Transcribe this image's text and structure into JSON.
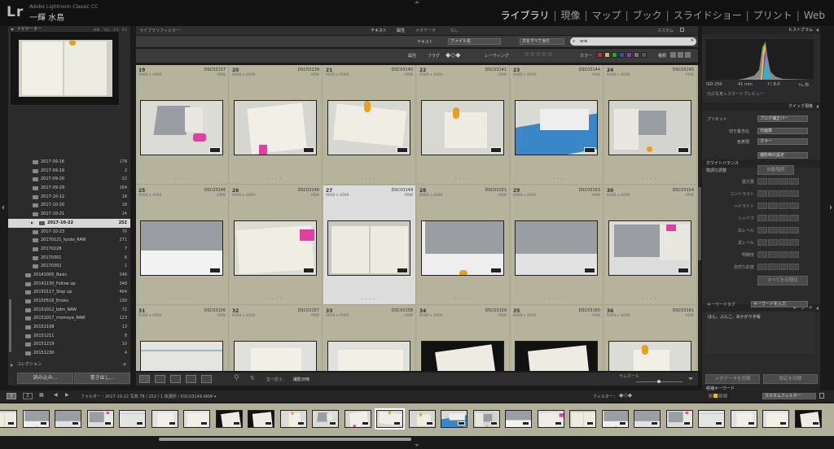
{
  "app": {
    "logo": "Lr",
    "name": "Adobe Lightroom Classic CC",
    "user": "一輝 水島"
  },
  "modules": [
    {
      "label": "ライブラリ",
      "active": true
    },
    {
      "label": "現像"
    },
    {
      "label": "マップ"
    },
    {
      "label": "ブック"
    },
    {
      "label": "スライドショー"
    },
    {
      "label": "プリント"
    },
    {
      "label": "Web"
    }
  ],
  "navigator": {
    "title": "ナビゲーター",
    "zoom": "全体 フル 1:1 3:1"
  },
  "folders": [
    {
      "name": "2017-09-16",
      "count": "178"
    },
    {
      "name": "2017-09-19",
      "count": "2"
    },
    {
      "name": "2017-09-20",
      "count": "22"
    },
    {
      "name": "2017-09-29",
      "count": "164"
    },
    {
      "name": "2017-10-12",
      "count": "18"
    },
    {
      "name": "2017-10-20",
      "count": "18"
    },
    {
      "name": "2017-10-21",
      "count": "14"
    },
    {
      "name": "2017-10-22",
      "count": "252",
      "selected": true
    },
    {
      "name": "2017-10-23",
      "count": "76"
    },
    {
      "name": "20170121_kyoto_RAW",
      "count": "271"
    },
    {
      "name": "20170228",
      "count": "7"
    },
    {
      "name": "20170301",
      "count": "6"
    },
    {
      "name": "20170302",
      "count": "1"
    },
    {
      "name": "20141005_Basic",
      "count": "246"
    },
    {
      "name": "20141130_Follow up",
      "count": "348"
    },
    {
      "name": "20150117_Step up",
      "count": "464"
    },
    {
      "name": "20150516_Enoku",
      "count": "130"
    },
    {
      "name": "20151012_bdm_RAW",
      "count": "72"
    },
    {
      "name": "20151017_momoya_RAW",
      "count": "123"
    },
    {
      "name": "20151108",
      "count": "13"
    },
    {
      "name": "20151211",
      "count": "8"
    },
    {
      "name": "20151219",
      "count": "10"
    },
    {
      "name": "20151230",
      "count": "4"
    }
  ],
  "collection": {
    "title": "コレクション"
  },
  "left_buttons": {
    "import": "読み込み...",
    "export": "書き出し..."
  },
  "filter": {
    "title": "ライブラリフィルター：",
    "tabs": [
      "テキスト",
      "属性",
      "メタデータ",
      "なし"
    ],
    "custom": "カスタム",
    "text_label": "テキスト",
    "field": "ファイル名",
    "rule": "次をすべて含む",
    "query": "arw",
    "attr_label": "属性",
    "flag_label": "フラグ",
    "rating_label": "レーティング",
    "rating_stars": "☆☆☆☆☆",
    "color_label": "カラー",
    "kind_label": "種類"
  },
  "grid": [
    {
      "num": "19",
      "name": "DSC03137",
      "size": "6000 x 4000",
      "type": "ARW"
    },
    {
      "num": "20",
      "name": "DSC03139",
      "size": "6000 x 4000",
      "type": "ARW"
    },
    {
      "num": "21",
      "name": "DSC03140",
      "size": "6000 x 4000",
      "type": "ARW"
    },
    {
      "num": "22",
      "name": "DSC03141",
      "size": "6000 x 4000",
      "type": "ARW"
    },
    {
      "num": "23",
      "name": "DSC03144",
      "size": "6000 x 4000",
      "type": "ARW"
    },
    {
      "num": "24",
      "name": "DSC03145",
      "size": "6000 x 4000",
      "type": "ARW"
    },
    {
      "num": "25",
      "name": "DSC03146",
      "size": "6000 x 4000",
      "type": "ARW"
    },
    {
      "num": "26",
      "name": "DSC03148",
      "size": "6000 x 4000",
      "type": "ARW"
    },
    {
      "num": "27",
      "name": "DSC03149",
      "size": "6000 x 4000",
      "type": "ARW",
      "selected": true
    },
    {
      "num": "28",
      "name": "DSC03151",
      "size": "6000 x 4000",
      "type": "ARW"
    },
    {
      "num": "29",
      "name": "DSC03153",
      "size": "6000 x 4000",
      "type": "ARW"
    },
    {
      "num": "30",
      "name": "DSC03154",
      "size": "6000 x 4000",
      "type": "ARW"
    },
    {
      "num": "31",
      "name": "DSC03156",
      "size": "6000 x 4000",
      "type": "ARW"
    },
    {
      "num": "32",
      "name": "DSC03157",
      "size": "6000 x 4000",
      "type": "ARW"
    },
    {
      "num": "33",
      "name": "DSC03158",
      "size": "6000 x 4000",
      "type": "ARW"
    },
    {
      "num": "34",
      "name": "DSC03159",
      "size": "6000 x 4000",
      "type": "ARW"
    },
    {
      "num": "35",
      "name": "DSC03160",
      "size": "6000 x 4000",
      "type": "ARW"
    },
    {
      "num": "36",
      "name": "DSC03161",
      "size": "6000 x 4000",
      "type": "ARW"
    }
  ],
  "toolbar": {
    "sort_label": "並べ替え：",
    "sort_value": "撮影日時",
    "thumb_label": "サムネール"
  },
  "histogram": {
    "title": "ヒストグラム",
    "iso": "ISO 250",
    "focal": "41 mm",
    "aperture": "f / 8.0",
    "shutter": "¹⁄₄₀ 秒",
    "caption": "元の写真＋スマートプレビュー"
  },
  "quick_develop": {
    "title": "クイック現像",
    "preset_label": "プリセット",
    "preset_value": "ブログ補正パー",
    "crop_label": "切り抜き比",
    "crop_value": "元画像",
    "treatment_label": "色表現",
    "treatment_value": "カラー",
    "wb_label": "ホワイトバランス",
    "wb_value": "撮影時の設定",
    "tone_label": "階調の調整",
    "auto_label": "自動階調",
    "rows": [
      "露光量",
      "コントラスト",
      "ハイライト",
      "シャドウ",
      "白レベル",
      "黒レベル",
      "明瞭度",
      "自然な彩度"
    ],
    "reset": "すべてを初期化"
  },
  "keywords": {
    "title": "キーワード",
    "tag_label": "キーワードタグ",
    "tag_value": "キーワードを入力",
    "content": "ほん，ぶんこ，あかがり手帳",
    "list_title": "候補キーワード"
  },
  "right_buttons": {
    "sync_meta": "メタデータを同期",
    "sync_settings": "設定を同期"
  },
  "filmstrip_bar": {
    "page1": "1",
    "page2": "2",
    "path": "フォルダー・2017-10-22 写真 78 / 252 / 1 枚選択 / DSC03149.ARW ▾",
    "filter_label": "フィルター：",
    "filter_value": "カスタムフィルター"
  }
}
